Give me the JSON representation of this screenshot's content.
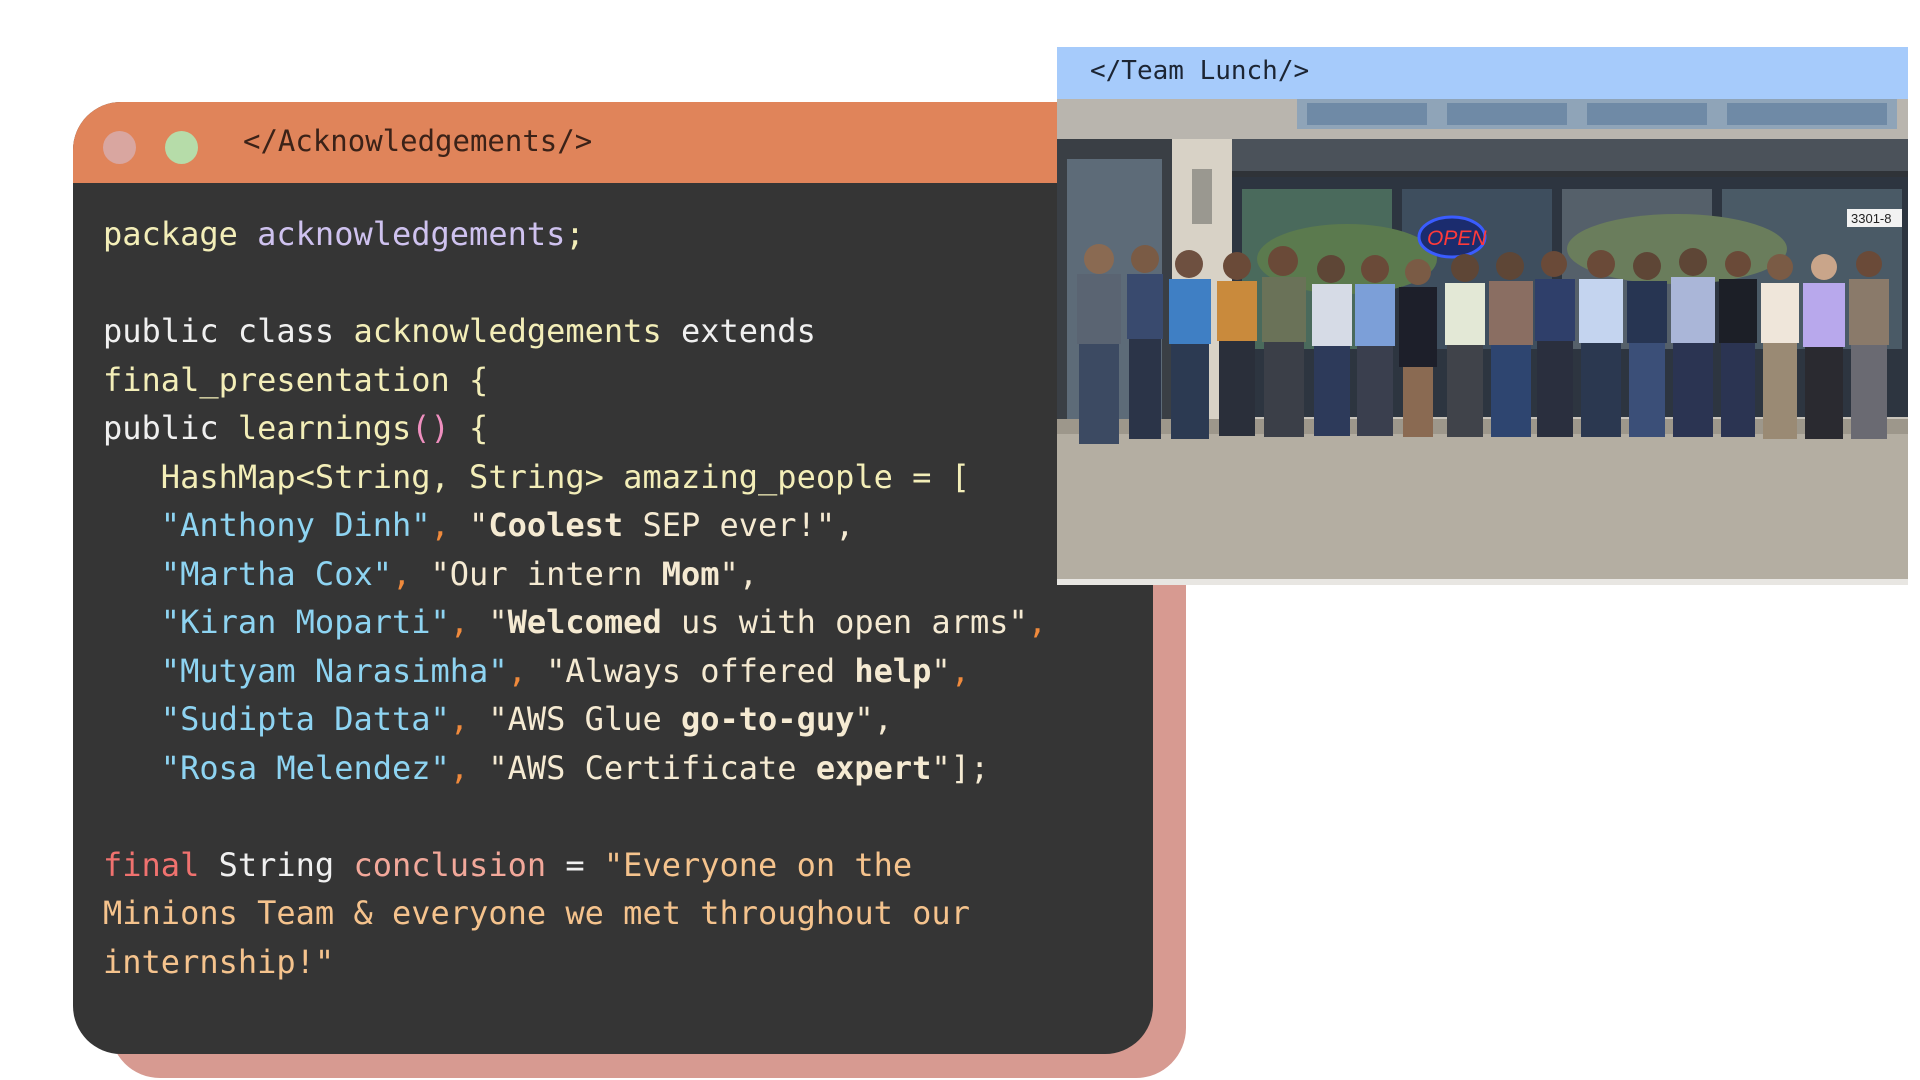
{
  "code_window": {
    "title": "</Acknowledgements/>",
    "lines": [
      [
        [
          "package ",
          "c-yellow",
          false
        ],
        [
          "acknowledgements",
          "c-purple",
          false
        ],
        [
          ";",
          "c-yellow",
          false
        ]
      ],
      [],
      [
        [
          "public ",
          "c-white",
          false
        ],
        [
          "class ",
          "c-white",
          false
        ],
        [
          "acknowledgements ",
          "c-yellow",
          false
        ],
        [
          "extends",
          "c-white",
          false
        ]
      ],
      [
        [
          "final_presentation {",
          "c-yellow",
          false
        ]
      ],
      [
        [
          "public ",
          "c-white",
          false
        ],
        [
          "learnings",
          "c-yellow",
          false
        ],
        [
          "()",
          "c-pink",
          false
        ],
        [
          " {",
          "c-yellow",
          false
        ]
      ],
      [
        [
          "   HashMap<String, String> amazing_people = [",
          "c-yellow",
          false
        ]
      ],
      [
        [
          "   \"Anthony Dinh\"",
          "c-blue",
          false
        ],
        [
          ", ",
          "c-orange",
          false
        ],
        [
          "\"",
          "c-cream",
          false
        ],
        [
          "Coolest",
          "c-cream",
          true
        ],
        [
          " SEP ever!\",",
          "c-cream",
          false
        ]
      ],
      [
        [
          "   \"Martha Cox\"",
          "c-blue",
          false
        ],
        [
          ", ",
          "c-orange",
          false
        ],
        [
          "\"Our intern ",
          "c-cream",
          false
        ],
        [
          "Mom",
          "c-cream",
          true
        ],
        [
          "\",",
          "c-cream",
          false
        ]
      ],
      [
        [
          "   \"Kiran Moparti\"",
          "c-blue",
          false
        ],
        [
          ", ",
          "c-orange",
          false
        ],
        [
          "\"",
          "c-cream",
          false
        ],
        [
          "Welcomed",
          "c-cream",
          true
        ],
        [
          " us with open arms\"",
          "c-cream",
          false
        ],
        [
          ",",
          "c-orange",
          false
        ]
      ],
      [
        [
          "   \"Mutyam Narasimha\"",
          "c-blue",
          false
        ],
        [
          ", ",
          "c-orange",
          false
        ],
        [
          "\"Always offered ",
          "c-cream",
          false
        ],
        [
          "help",
          "c-cream",
          true
        ],
        [
          "\"",
          "c-cream",
          false
        ],
        [
          ",",
          "c-orange",
          false
        ]
      ],
      [
        [
          "   \"Sudipta Datta\"",
          "c-blue",
          false
        ],
        [
          ", ",
          "c-orange",
          false
        ],
        [
          "\"AWS Glue ",
          "c-cream",
          false
        ],
        [
          "go-to-guy",
          "c-cream",
          true
        ],
        [
          "\",",
          "c-cream",
          false
        ]
      ],
      [
        [
          "   \"Rosa Melendez\"",
          "c-blue",
          false
        ],
        [
          ", ",
          "c-orange",
          false
        ],
        [
          "\"AWS Certificate ",
          "c-cream",
          false
        ],
        [
          "expert",
          "c-cream",
          true
        ],
        [
          "\"];",
          "c-cream",
          false
        ]
      ],
      [],
      [
        [
          "final ",
          "c-red",
          false
        ],
        [
          "String ",
          "c-white",
          false
        ],
        [
          "conclusion",
          "c-salmon",
          false
        ],
        [
          " = ",
          "c-white",
          false
        ],
        [
          "\"Everyone on the",
          "c-peach",
          false
        ]
      ],
      [
        [
          "Minions Team & everyone we met throughout our",
          "c-peach",
          false
        ]
      ],
      [
        [
          "internship!\"",
          "c-peach",
          false
        ]
      ]
    ]
  },
  "photo_window": {
    "title": "</Team Lunch/>",
    "sign_text": "OPEN",
    "address_text": "3301-8"
  }
}
